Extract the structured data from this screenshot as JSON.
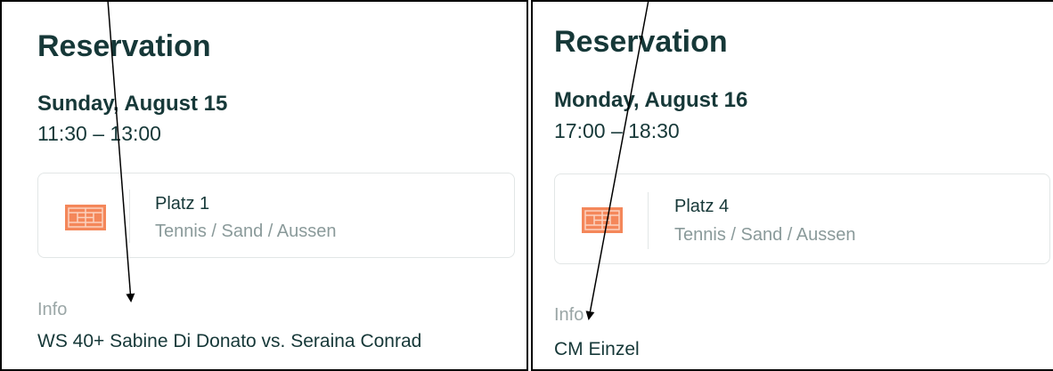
{
  "reservations": [
    {
      "title": "Reservation",
      "day": "Sunday, August 15",
      "time": "11:30 – 13:00",
      "court": {
        "name": "Platz 1",
        "type": "Tennis / Sand / Aussen",
        "icon": "tennis-court-icon"
      },
      "info_label": "Info",
      "info_value": "WS 40+ Sabine Di Donato vs. Seraina Conrad"
    },
    {
      "title": "Reservation",
      "day": "Monday, August 16",
      "time": "17:00 – 18:30",
      "court": {
        "name": "Platz 4",
        "type": "Tennis / Sand / Aussen",
        "icon": "tennis-court-icon"
      },
      "info_label": "Info",
      "info_value": "CM Einzel"
    }
  ],
  "colors": {
    "text_dark": "#163838",
    "text_muted": "#8a9a9a",
    "court_orange": "#f4875a",
    "card_border": "#e2e6e6"
  }
}
